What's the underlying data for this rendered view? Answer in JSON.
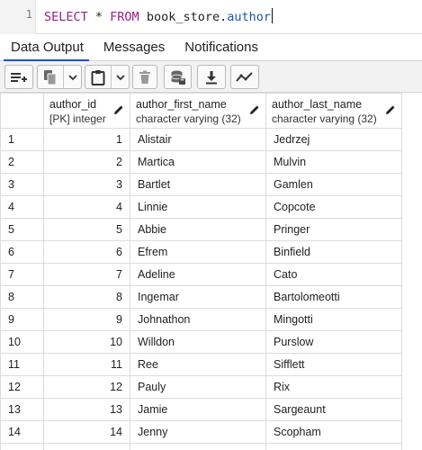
{
  "editor": {
    "line_number": "1",
    "tokens": {
      "select": "SELECT",
      "star": " * ",
      "from": "FROM",
      "schema": " book_store.",
      "table": "author"
    }
  },
  "tabs": [
    {
      "label": "Data Output",
      "active": true
    },
    {
      "label": "Messages",
      "active": false
    },
    {
      "label": "Notifications",
      "active": false
    }
  ],
  "toolbar": {
    "icons": [
      "add-row-icon",
      "copy-icon",
      "chevron-down-icon",
      "paste-icon",
      "chevron-down-icon",
      "delete-icon",
      "save-data-icon",
      "download-icon",
      "graph-icon"
    ]
  },
  "grid": {
    "columns": [
      {
        "name": "author_id",
        "type": "[PK] integer"
      },
      {
        "name": "author_first_name",
        "type": "character varying (32)"
      },
      {
        "name": "author_last_name",
        "type": "character varying (32)"
      }
    ],
    "rows": [
      {
        "n": "1",
        "id": "1",
        "first": "Alistair",
        "last": "Jedrzej"
      },
      {
        "n": "2",
        "id": "2",
        "first": "Martica",
        "last": "Mulvin"
      },
      {
        "n": "3",
        "id": "3",
        "first": "Bartlet",
        "last": "Gamlen"
      },
      {
        "n": "4",
        "id": "4",
        "first": "Linnie",
        "last": "Copcote"
      },
      {
        "n": "5",
        "id": "5",
        "first": "Abbie",
        "last": "Pringer"
      },
      {
        "n": "6",
        "id": "6",
        "first": "Efrem",
        "last": "Binfield"
      },
      {
        "n": "7",
        "id": "7",
        "first": "Adeline",
        "last": "Cato"
      },
      {
        "n": "8",
        "id": "8",
        "first": "Ingemar",
        "last": "Bartolomeotti"
      },
      {
        "n": "9",
        "id": "9",
        "first": "Johnathon",
        "last": "Mingotti"
      },
      {
        "n": "10",
        "id": "10",
        "first": "Willdon",
        "last": "Purslow"
      },
      {
        "n": "11",
        "id": "11",
        "first": "Ree",
        "last": "Sifflett"
      },
      {
        "n": "12",
        "id": "12",
        "first": "Pauly",
        "last": "Rix"
      },
      {
        "n": "13",
        "id": "13",
        "first": "Jamie",
        "last": "Sargeaunt"
      },
      {
        "n": "14",
        "id": "14",
        "first": "Jenny",
        "last": "Scopham"
      }
    ]
  }
}
